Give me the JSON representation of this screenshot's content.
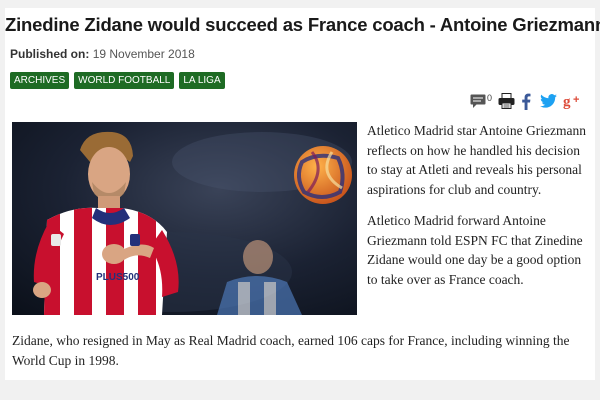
{
  "article": {
    "title": "Zinedine Zidane would succeed as France coach - Antoine Griezmann",
    "published_label": "Published on:",
    "published_date": "19 November 2018",
    "tags": [
      "ARCHIVES",
      "WORLD FOOTBALL",
      "LA LIGA"
    ],
    "comment_count": "0",
    "paragraphs": [
      "Atletico Madrid star Antoine Griezmann reflects on how he handled his decision to stay at Atleti and reveals his personal aspirations for club and country.",
      "Atletico Madrid forward Antoine Griezmann told ESPN FC that Zinedine Zidane would one day be a good option to take over as France coach."
    ],
    "bottom_paragraph": "Zidane, who resigned in May as Real Madrid coach, earned 106 caps for France, including winning the World Cup in 1998.",
    "photo": {
      "jersey_text": "PLUS500"
    }
  },
  "share_icons": [
    "comment-icon",
    "print-icon",
    "facebook-icon",
    "twitter-icon",
    "google-plus-icon"
  ],
  "colors": {
    "tag_bg": "#1e6b24",
    "facebook": "#3b5998",
    "twitter": "#1da1f2",
    "google_plus": "#dd4b39",
    "jersey_red": "#c8102e"
  }
}
